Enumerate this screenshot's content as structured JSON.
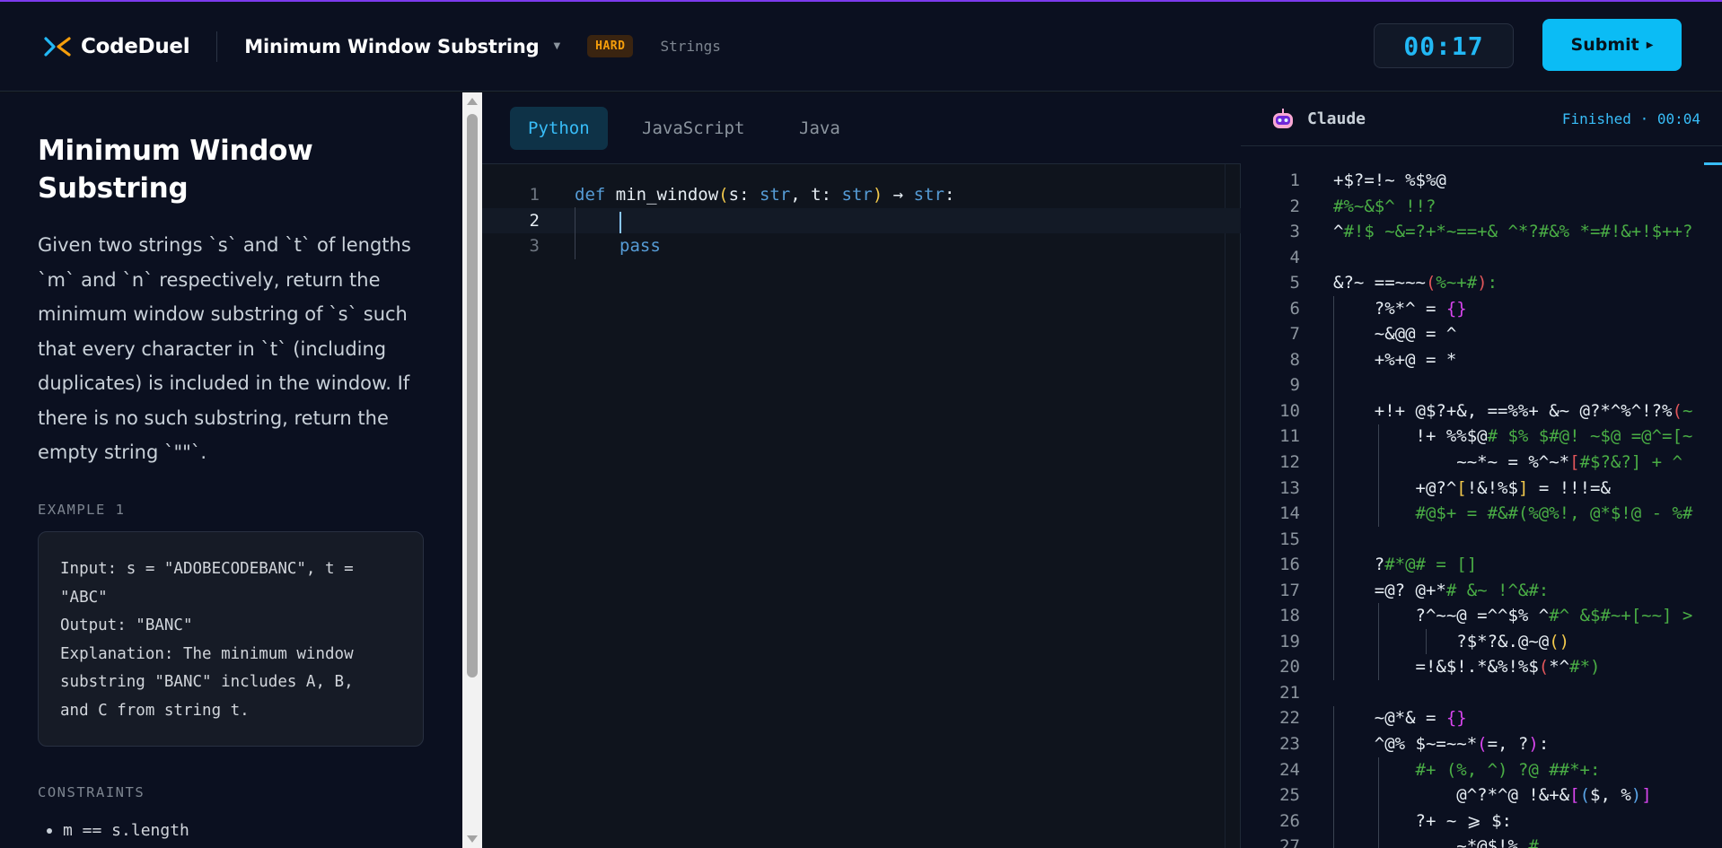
{
  "app": {
    "name": "CodeDuel"
  },
  "header": {
    "problem_title": "Minimum Window Substring",
    "difficulty": "HARD",
    "tag": "Strings",
    "timer": "00:17",
    "submit_label": "Submit",
    "submit_icon": "play-triangle-icon"
  },
  "problem": {
    "title": "Minimum Window Substring",
    "description": "Given two strings `s` and `t` of lengths `m` and `n` respectively, return the minimum window substring of `s` such that every character in `t` (including duplicates) is included in the window. If there is no such substring, return the empty string `\"\"`.",
    "example_label": "EXAMPLE 1",
    "example_text": "Input: s = \"ADOBECODEBANC\", t =\n\"ABC\"\nOutput: \"BANC\"\nExplanation: The minimum window\nsubstring \"BANC\" includes A, B,\nand C from string t.",
    "constraints_label": "CONSTRAINTS",
    "constraints": [
      "m == s.length"
    ]
  },
  "editor": {
    "languages": [
      "Python",
      "JavaScript",
      "Java"
    ],
    "active_language": "Python",
    "line_numbers": [
      "1",
      "2",
      "3"
    ],
    "current_line": 2,
    "code": {
      "kw_def": "def",
      "fn_name": " min_window",
      "paren_open": "(",
      "param_s": "s: ",
      "type_str1": "str",
      "comma": ", ",
      "param_t": "t: ",
      "type_str2": "str",
      "paren_close": ")",
      "arrow": " → ",
      "type_str3": "str",
      "colon": ":",
      "line3": "pass"
    }
  },
  "opponent": {
    "name": "Claude",
    "icon": "robot-icon",
    "status": "Finished · 00:04",
    "line_numbers": [
      "1",
      "2",
      "3",
      "4",
      "5",
      "6",
      "7",
      "8",
      "9",
      "10",
      "11",
      "12",
      "13",
      "14",
      "15",
      "16",
      "17",
      "18",
      "19",
      "20",
      "21",
      "22",
      "23",
      "24",
      "25",
      "26",
      "27"
    ]
  },
  "colors": {
    "accent": "#0bbcf5",
    "difficulty_hard": "#f59e0b",
    "background": "#0b1020",
    "top_line": "#7c3aed"
  }
}
